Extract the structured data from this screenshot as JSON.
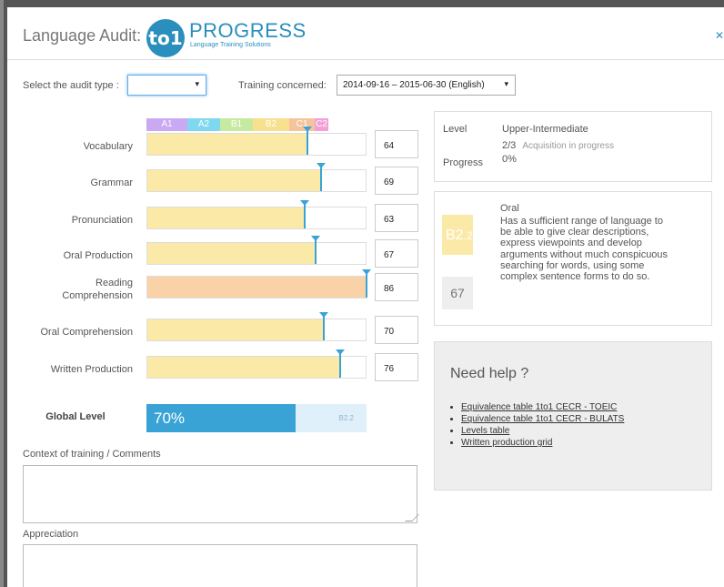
{
  "header": {
    "title": "Language Audit:",
    "logo_mark": "to1",
    "logo_name": "PROGRESS",
    "logo_tagline": "Language Training Solutions",
    "close_icon": "close-icon"
  },
  "filters": {
    "audit_type_label": "Select the audit type :",
    "audit_type_value": "",
    "training_label": "Training concerned:",
    "training_value": "2014-09-16 – 2015-06-30 (English)"
  },
  "levels": [
    {
      "label": "A1",
      "color": "#c9a9f2"
    },
    {
      "label": "A2",
      "color": "#7fd8ef"
    },
    {
      "label": "B1",
      "color": "#c6eaa0"
    },
    {
      "label": "B2",
      "color": "#f7e08e"
    },
    {
      "label": "C1",
      "color": "#f6c49a"
    },
    {
      "label": "C2",
      "color": "#f39fd8"
    }
  ],
  "skills": [
    {
      "label": "Vocabulary",
      "score": "64",
      "fill_color": "#fbe9a8"
    },
    {
      "label": "Grammar",
      "score": "69",
      "fill_color": "#fbe9a8"
    },
    {
      "label": "Pronunciation",
      "score": "63",
      "fill_color": "#fbe9a8"
    },
    {
      "label": "Oral Production",
      "score": "67",
      "fill_color": "#fbe9a8"
    },
    {
      "label": "Reading Comprehension",
      "score": "86",
      "fill_color": "#f9d2a8"
    },
    {
      "label": "Oral Comprehension",
      "score": "70",
      "fill_color": "#fbe9a8"
    },
    {
      "label": "Written Production",
      "score": "76",
      "fill_color": "#fbe9a8"
    }
  ],
  "global": {
    "label": "Global Level",
    "percent_text": "70%",
    "percent": 0.7,
    "level": "B2.2"
  },
  "comments": {
    "context_label": "Context of training / Comments",
    "appreciation_label": "Appreciation"
  },
  "level_panel": {
    "level_label": "Level",
    "level_value": "Upper-Intermediate",
    "acq_fraction": "2/3",
    "acq_text": "Acquisition in progress",
    "progress_label": "Progress",
    "progress_value": "0%"
  },
  "oral_panel": {
    "title": "Oral",
    "badge_main": "B2",
    "badge_sub": ".2",
    "badge_color": "#fbe9a8",
    "score": "67",
    "description": "Has a sufficient range of language to be able to give clear descriptions, express viewpoints and develop arguments without much conspicuous searching for words, using some complex sentence forms to do so."
  },
  "help": {
    "title": "Need help ?",
    "links": [
      "Equivalence table 1to1 CECR - TOEIC",
      "Equivalence table 1to1 CECR - BULATS",
      "Levels table",
      "Written production grid"
    ]
  }
}
